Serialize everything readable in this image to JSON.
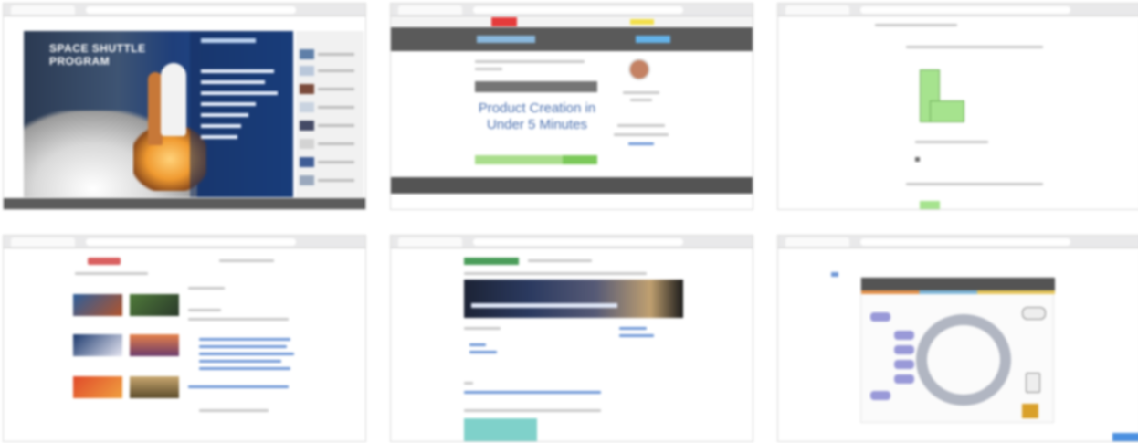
{
  "grid": {
    "tiles": [
      {
        "id": "space-shuttle",
        "title": "SPACE SHUTTLE PROGRAM"
      },
      {
        "id": "product-creation",
        "headline": "Product Creation in Under 5 Minutes"
      },
      {
        "id": "shape-exercise"
      },
      {
        "id": "photo-gallery"
      },
      {
        "id": "galaxy-course"
      },
      {
        "id": "concept-diagram"
      }
    ]
  },
  "colors": {
    "shuttle_sky": "#1f3f7a",
    "product_header": "#5a5a5a",
    "shape_green": "#a6e38e",
    "gallery_logo": "#d96060",
    "galaxy_logo": "#4b9d5a",
    "diagram_node": "#9999d8",
    "link_blue": "#6f97d6"
  }
}
